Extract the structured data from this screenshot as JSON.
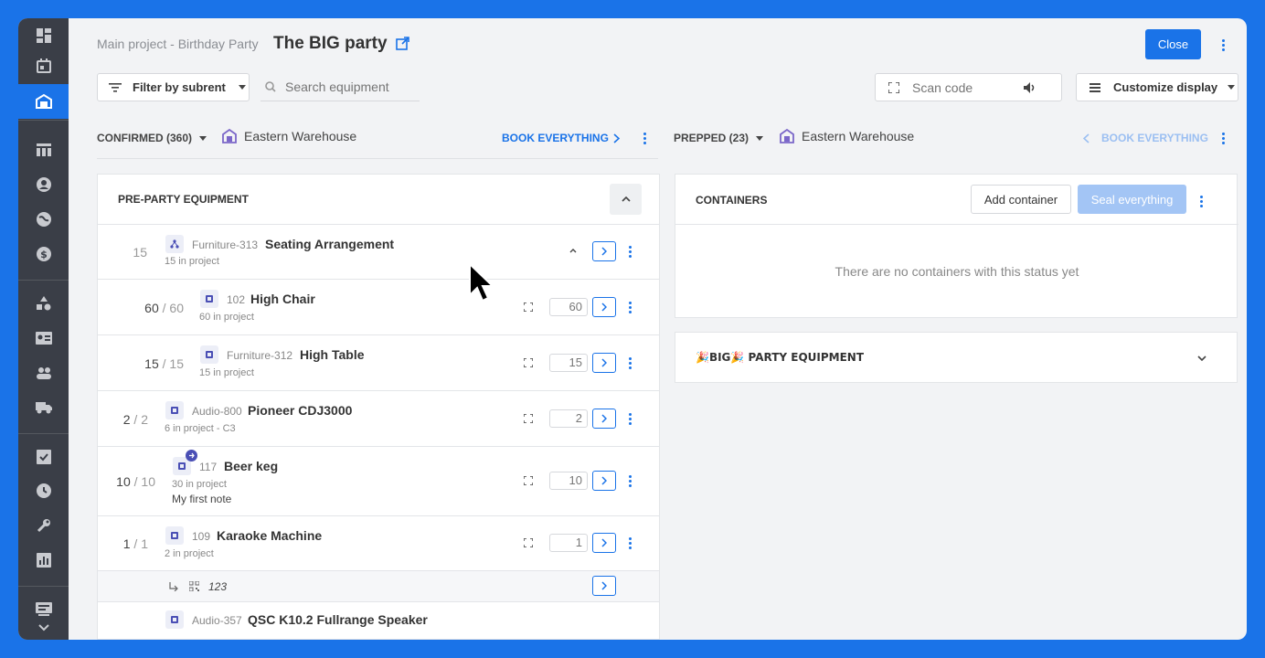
{
  "header": {
    "breadcrumb": "Main project - Birthday Party",
    "title": "The BIG party",
    "close_label": "Close"
  },
  "toolbar": {
    "filter_label": "Filter by subrent",
    "search_placeholder": "Search equipment",
    "scan_placeholder": "Scan code",
    "customize_label": "Customize display"
  },
  "left_panel": {
    "status_label": "CONFIRMED (360)",
    "warehouse": "Eastern Warehouse",
    "book_label": "BOOK EVERYTHING",
    "section_title": "PRE-PARTY EQUIPMENT",
    "group": {
      "count": "15",
      "code": "Furniture-313",
      "name": "Seating Arrangement",
      "sub": "15 in project"
    },
    "items": [
      {
        "done": "60",
        "total": "60",
        "code": "102",
        "name": "High Chair",
        "sub": "60 in project",
        "qty": "60"
      },
      {
        "done": "15",
        "total": "15",
        "code": "Furniture-312",
        "name": "High Table",
        "sub": "15 in project",
        "qty": "15"
      },
      {
        "done": "2",
        "total": "2",
        "code": "Audio-800",
        "name": "Pioneer CDJ3000",
        "sub": "6 in project - C3",
        "qty": "2"
      },
      {
        "done": "10",
        "total": "10",
        "code": "117",
        "name": "Beer keg",
        "sub": "30 in project",
        "note": "My first note",
        "qty": "10"
      },
      {
        "done": "1",
        "total": "1",
        "code": "109",
        "name": "Karaoke Machine",
        "sub": "2 in project",
        "qty": "1"
      },
      {
        "code": "Audio-357",
        "name": "QSC K10.2 Fullrange Speaker"
      }
    ],
    "serial": "123"
  },
  "right_panel": {
    "status_label": "PREPPED (23)",
    "warehouse": "Eastern Warehouse",
    "book_label": "BOOK EVERYTHING",
    "containers_title": "CONTAINERS",
    "add_container_label": "Add container",
    "seal_label": "Seal everything",
    "empty_message": "There are no containers with this status yet",
    "section_title": "🎉BIG🎉 PARTY EQUIPMENT"
  },
  "colors": {
    "accent": "#1a73e8",
    "sidebar": "#3a3e47",
    "background": "#f2f3f5"
  }
}
